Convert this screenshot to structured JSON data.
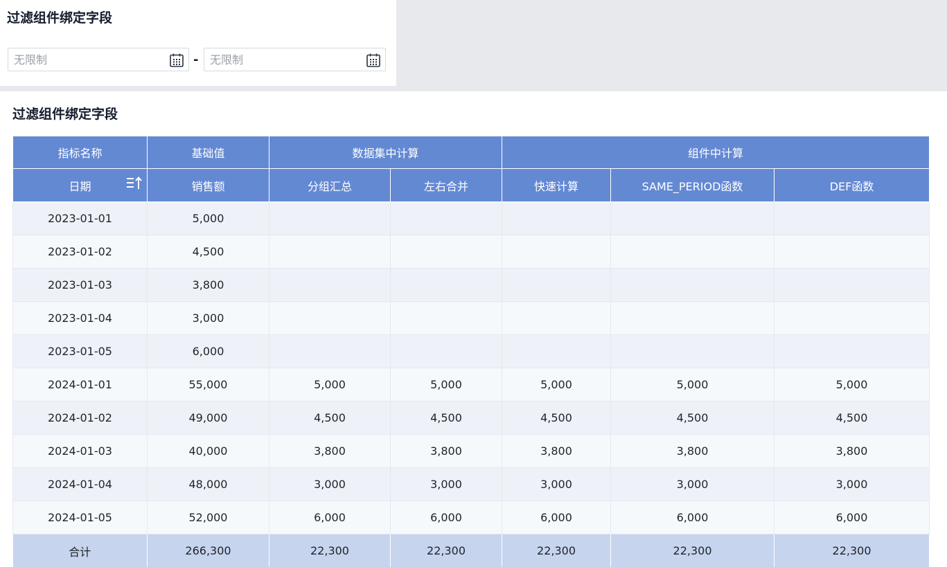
{
  "filter": {
    "title": "过滤组件绑定字段",
    "start_placeholder": "无限制",
    "end_placeholder": "无限制",
    "separator": "-"
  },
  "table": {
    "title": "过滤组件绑定字段",
    "header_groups": [
      "指标名称",
      "基础值",
      "数据集中计算",
      "组件中计算"
    ],
    "columns": [
      "日期",
      "销售额",
      "分组汇总",
      "左右合并",
      "快速计算",
      "SAME_PERIOD函数",
      "DEF函数"
    ],
    "rows": [
      [
        "2023-01-01",
        "5,000",
        "",
        "",
        "",
        "",
        ""
      ],
      [
        "2023-01-02",
        "4,500",
        "",
        "",
        "",
        "",
        ""
      ],
      [
        "2023-01-03",
        "3,800",
        "",
        "",
        "",
        "",
        ""
      ],
      [
        "2023-01-04",
        "3,000",
        "",
        "",
        "",
        "",
        ""
      ],
      [
        "2023-01-05",
        "6,000",
        "",
        "",
        "",
        "",
        ""
      ],
      [
        "2024-01-01",
        "55,000",
        "5,000",
        "5,000",
        "5,000",
        "5,000",
        "5,000"
      ],
      [
        "2024-01-02",
        "49,000",
        "4,500",
        "4,500",
        "4,500",
        "4,500",
        "4,500"
      ],
      [
        "2024-01-03",
        "40,000",
        "3,800",
        "3,800",
        "3,800",
        "3,800",
        "3,800"
      ],
      [
        "2024-01-04",
        "48,000",
        "3,000",
        "3,000",
        "3,000",
        "3,000",
        "3,000"
      ],
      [
        "2024-01-05",
        "52,000",
        "6,000",
        "6,000",
        "6,000",
        "6,000",
        "6,000"
      ]
    ],
    "total": [
      "合计",
      "266,300",
      "22,300",
      "22,300",
      "22,300",
      "22,300",
      "22,300"
    ]
  },
  "colors": {
    "header_bg": "#6489d3",
    "total_bg": "#c6d4ee",
    "row_odd": "#eef2f8",
    "row_even": "#f6f9fc",
    "page_bg": "#e8e9ed"
  },
  "icons": {
    "date_picker": "calendar-icon",
    "sort": "sort-ascending-icon"
  }
}
